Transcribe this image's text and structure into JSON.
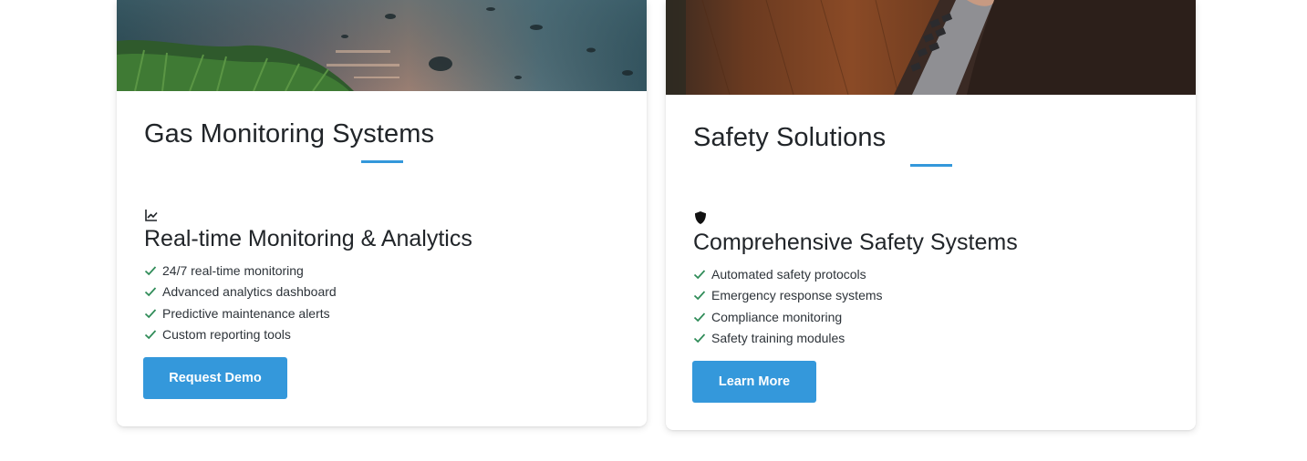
{
  "cards": [
    {
      "title": "Gas Monitoring Systems",
      "feature_icon": "chart-line-icon",
      "feature_title": "Real-time Monitoring & Analytics",
      "features": [
        "24/7 real-time monitoring",
        "Advanced analytics dashboard",
        "Predictive maintenance alerts",
        "Custom reporting tools"
      ],
      "button_label": "Request Demo"
    },
    {
      "title": "Safety Solutions",
      "feature_icon": "shield-icon",
      "feature_title": "Comprehensive Safety Systems",
      "features": [
        "Automated safety protocols",
        "Emergency response systems",
        "Compliance monitoring",
        "Safety training modules"
      ],
      "button_label": "Learn More"
    }
  ],
  "colors": {
    "accent": "#3498db",
    "check": "#2e8b57",
    "heading": "#212529"
  }
}
